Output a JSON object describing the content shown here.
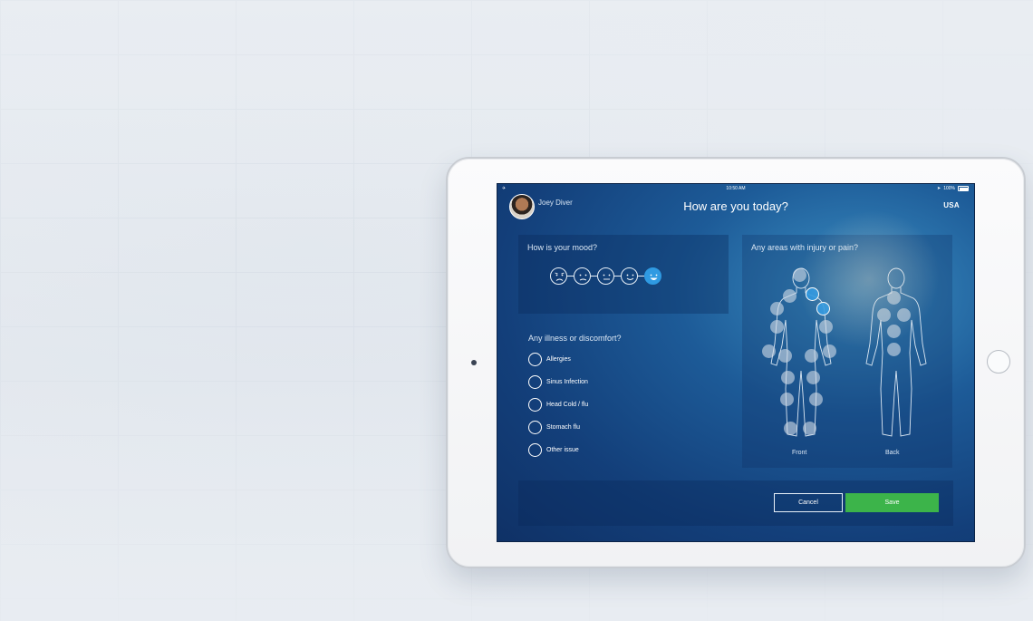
{
  "status": {
    "time": "10:50 AM",
    "battery": "100%"
  },
  "header": {
    "username": "Joey Diver",
    "title": "How are you today?",
    "logo": "USA"
  },
  "mood": {
    "label": "How is your mood?",
    "faces": [
      "very-sad-face-icon",
      "sad-face-icon",
      "neutral-face-icon",
      "happy-face-icon",
      "very-happy-face-icon"
    ],
    "selected_index": 4
  },
  "illness": {
    "label": "Any illness or discomfort?",
    "options": [
      "Allergies",
      "Sinus Infection",
      "Head Cold / flu",
      "Stomach flu",
      "Other issue"
    ]
  },
  "body": {
    "label": "Any areas with injury or pain?",
    "front_caption": "Front",
    "back_caption": "Back"
  },
  "actions": {
    "cancel": "Cancel",
    "save": "Save"
  },
  "colors": {
    "accent": "#2f9ae2",
    "save": "#3cb44a"
  }
}
